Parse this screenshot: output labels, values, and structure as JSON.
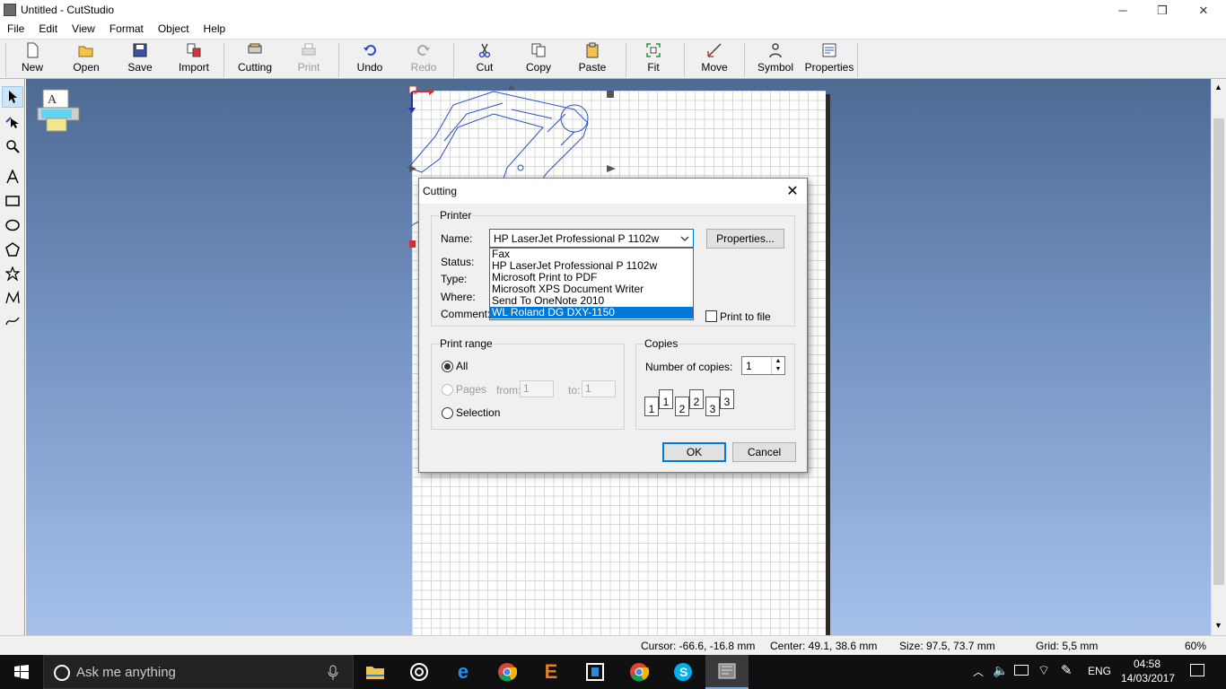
{
  "window": {
    "title": "Untitled - CutStudio",
    "minimize": "─",
    "restore": "❐",
    "close": "✕"
  },
  "menu": [
    "File",
    "Edit",
    "View",
    "Format",
    "Object",
    "Help"
  ],
  "toolbar": {
    "new": "New",
    "open": "Open",
    "save": "Save",
    "import": "Import",
    "cutting": "Cutting",
    "print": "Print",
    "undo": "Undo",
    "redo": "Redo",
    "cut": "Cut",
    "copy": "Copy",
    "paste": "Paste",
    "fit": "Fit",
    "move": "Move",
    "symbol": "Symbol",
    "properties": "Properties"
  },
  "lefttools": [
    "select-tool",
    "node-edit-tool",
    "zoom-tool",
    "text-tool",
    "rectangle-tool",
    "ellipse-tool",
    "polygon-tool",
    "star-tool",
    "polyline-tool",
    "curve-tool"
  ],
  "status": {
    "cursor": "Cursor: -66.6, -16.8 mm",
    "center": "Center: 49.1, 38.6 mm",
    "size": "Size: 97.5, 73.7 mm",
    "grid": "Grid: 5,5 mm",
    "zoom": "60%"
  },
  "dialog": {
    "title": "Cutting",
    "printer_group": "Printer",
    "name_label": "Name:",
    "name_value": "HP LaserJet Professional P 1102w",
    "properties_button": "Properties...",
    "status_label": "Status:",
    "type_label": "Type:",
    "where_label": "Where:",
    "comment_label": "Comment:",
    "print_to_file": "Print to file",
    "dropdown_options": [
      "Fax",
      "HP LaserJet Professional P 1102w",
      "Microsoft Print to PDF",
      "Microsoft XPS Document Writer",
      "Send To OneNote 2010",
      "WL Roland DG DXY-1150"
    ],
    "dropdown_highlight_index": 5,
    "print_range_group": "Print range",
    "all_label": "All",
    "pages_label": "Pages",
    "from_label": "from:",
    "from_value": "1",
    "to_label": "to:",
    "to_value": "1",
    "selection_label": "Selection",
    "copies_group": "Copies",
    "number_of_copies_label": "Number of copies:",
    "copies_value": "1",
    "collate_pages": [
      "1",
      "1",
      "2",
      "2",
      "3",
      "3"
    ],
    "ok_button": "OK",
    "cancel_button": "Cancel"
  },
  "taskbar": {
    "search_placeholder": "Ask me anything",
    "time": "04:58",
    "date": "14/03/2017",
    "language": "ENG"
  },
  "colors": {
    "canvas_top": "#4d6a93",
    "canvas_bottom": "#a6c0ea",
    "accent": "#0078d7",
    "taskbar": "#101010",
    "drawing_line": "#2b4fc9"
  }
}
